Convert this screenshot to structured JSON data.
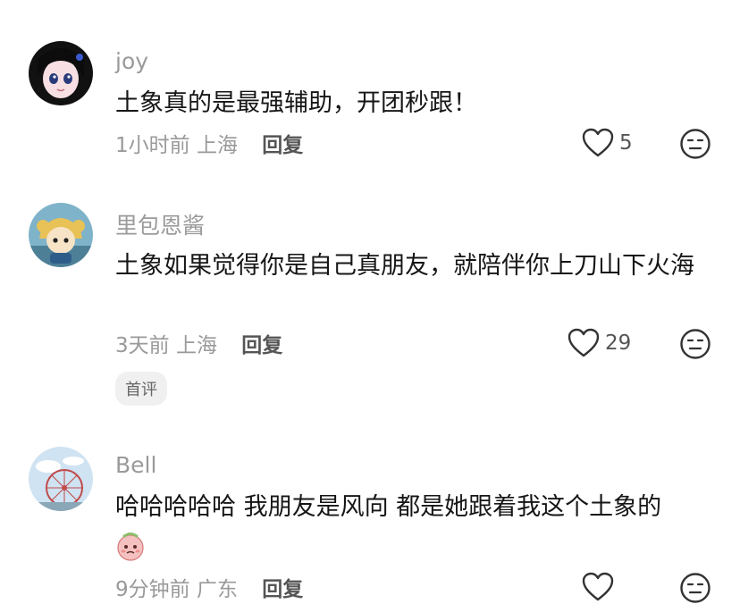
{
  "comments": [
    {
      "username": "joy",
      "text": "土象真的是最强辅助，开团秒跟！",
      "time": "1小时前",
      "location": "上海",
      "reply_label": "回复",
      "likes": "5",
      "avatar_icon": "anime-girl-avatar"
    },
    {
      "username": "里包恩酱",
      "text": "土象如果觉得你是自己真朋友，就陪伴你上刀山下火海",
      "time": "3天前",
      "location": "上海",
      "reply_label": "回复",
      "likes": "29",
      "badge": "首评",
      "avatar_icon": "cartoon-character-avatar"
    },
    {
      "username": "Bell",
      "text": "哈哈哈哈哈 我朋友是风向 都是她跟着我这个土象的",
      "time": "9分钟前",
      "location": "广东",
      "reply_label": "回复",
      "likes": "",
      "emoji_icon": "pleading-face-emoji",
      "avatar_icon": "ferris-wheel-avatar"
    }
  ],
  "colors": {
    "meta_text": "#9a9a9a",
    "body_text": "#161616",
    "reply_text": "#555555",
    "badge_bg": "#f0f0f0"
  }
}
